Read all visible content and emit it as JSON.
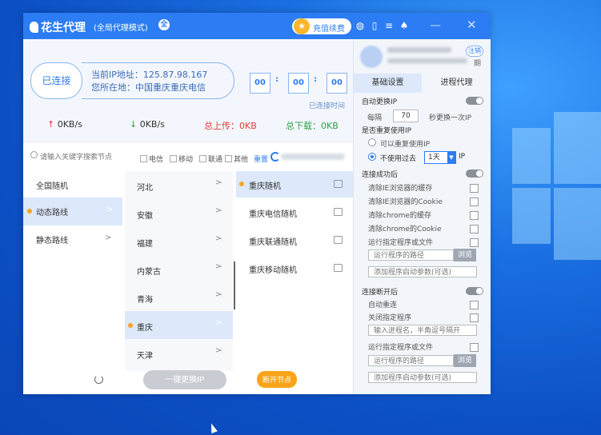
{
  "app": {
    "name": "花生代理",
    "mode": "(全局代理模式)",
    "recharge_label": "充值续费",
    "colors": {
      "accent": "#2c7cf3",
      "orange": "#f9a51a",
      "desktop": "#1a6fe0"
    }
  },
  "titlebar_icons": [
    "globe-icon",
    "window-icon",
    "menu-icon",
    "bell-icon",
    "minimize-icon",
    "close-icon"
  ],
  "status": {
    "connect_label": "已连接",
    "ip_label": "当前IP地址：125.87.98.167",
    "location_label": "您所在地：中国重庆重庆电信",
    "timer": [
      "00",
      "00",
      "00"
    ],
    "timer_sep": ":",
    "timer_caption": "已连接时间",
    "upload_speed": "0KB/s",
    "download_speed": "0KB/s",
    "total_upload": "总上传：0KB",
    "total_download": "总下载：0KB"
  },
  "filters": {
    "search_placeholder": "请输入关键字搜索节点",
    "options": [
      "电信",
      "移动",
      "联通",
      "其他"
    ],
    "reset_label": "重置"
  },
  "col1": [
    "全国随机",
    "动态路线",
    "静态路线"
  ],
  "col2": [
    "河北",
    "安徽",
    "福建",
    "内蒙古",
    "青海",
    "重庆",
    "天津"
  ],
  "col3": [
    "重庆随机",
    "重庆电信随机",
    "重庆联通随机",
    "重庆移动随机"
  ],
  "actions": {
    "one_key_label": "一键更换IP",
    "disconnect_label": "断开节点"
  },
  "account": {
    "logout_label": "注销",
    "expire_suffix": "期"
  },
  "tabs": [
    "基础设置",
    "进程代理"
  ],
  "settings": {
    "auto_ip_label": "自动更换IP",
    "every_label": "每隔",
    "interval": "70",
    "interval_suffix": "秒更换一次IP",
    "reuse_label": "是否重复使用IP",
    "reuse_yes": "可以重复使用IP",
    "reuse_no": "不使用过去",
    "reuse_days": "1天",
    "reuse_unit": "IP",
    "on_connect_label": "连接成功后",
    "on_connect_items": [
      "清除IE浏览器的缓存",
      "清除IE浏览器的Cookie",
      "清除chrome的缓存",
      "清除chrome的Cookie",
      "运行指定程序或文件"
    ],
    "program_path_placeholder": "运行程序的路径",
    "browse_label": "浏览",
    "program_args_placeholder": "添加程序启动参数(可选)",
    "on_disconnect_label": "连接断开后",
    "auto_reconnect_label": "自动重连",
    "close_program_label": "关闭指定程序",
    "process_name_placeholder": "输入进程名，半角逗号隔开",
    "run_program_label": "运行指定程序或文件",
    "program_path_placeholder2": "运行程序的路径",
    "browse_label2": "浏览",
    "program_args_placeholder2": "添加程序启动参数(可选)"
  }
}
